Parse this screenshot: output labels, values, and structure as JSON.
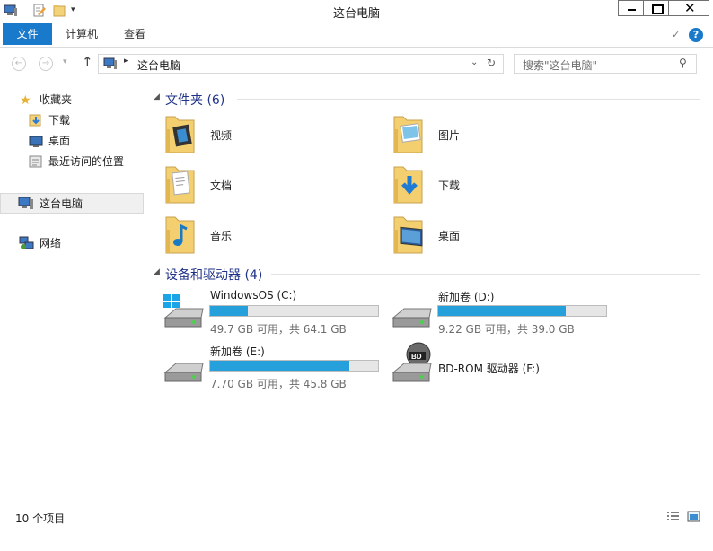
{
  "window": {
    "title": "这台电脑"
  },
  "ribbon": {
    "tabs": [
      {
        "label": "文件"
      },
      {
        "label": "计算机"
      },
      {
        "label": "查看"
      }
    ]
  },
  "address": {
    "path": "这台电脑",
    "search_placeholder": "搜索\"这台电脑\""
  },
  "nav": {
    "favorites_label": "收藏夹",
    "favorites": [
      {
        "label": "下载"
      },
      {
        "label": "桌面"
      },
      {
        "label": "最近访问的位置"
      }
    ],
    "this_pc": "这台电脑",
    "network": "网络"
  },
  "main": {
    "folders_header": "文件夹 (6)",
    "folders": [
      {
        "label": "视频",
        "icon": "video-folder-icon"
      },
      {
        "label": "图片",
        "icon": "pictures-folder-icon"
      },
      {
        "label": "文档",
        "icon": "documents-folder-icon"
      },
      {
        "label": "下载",
        "icon": "downloads-folder-icon"
      },
      {
        "label": "音乐",
        "icon": "music-folder-icon"
      },
      {
        "label": "桌面",
        "icon": "desktop-folder-icon"
      }
    ],
    "drives_header": "设备和驱动器 (4)",
    "drives": [
      {
        "label": "WindowsOS (C:)",
        "usage": "49.7 GB 可用，共 64.1 GB",
        "used_fraction": 0.225
      },
      {
        "label": "新加卷 (D:)",
        "usage": "9.22 GB 可用，共 39.0 GB",
        "used_fraction": 0.76
      },
      {
        "label": "新加卷 (E:)",
        "usage": "7.70 GB 可用，共 45.8 GB",
        "used_fraction": 0.83
      },
      {
        "label": "BD-ROM 驱动器 (F:)"
      }
    ]
  },
  "status": {
    "item_count": "10 个项目"
  },
  "colors": {
    "accent": "#1979ca",
    "bar_fill": "#26a0da",
    "group_header": "#1e3287"
  }
}
